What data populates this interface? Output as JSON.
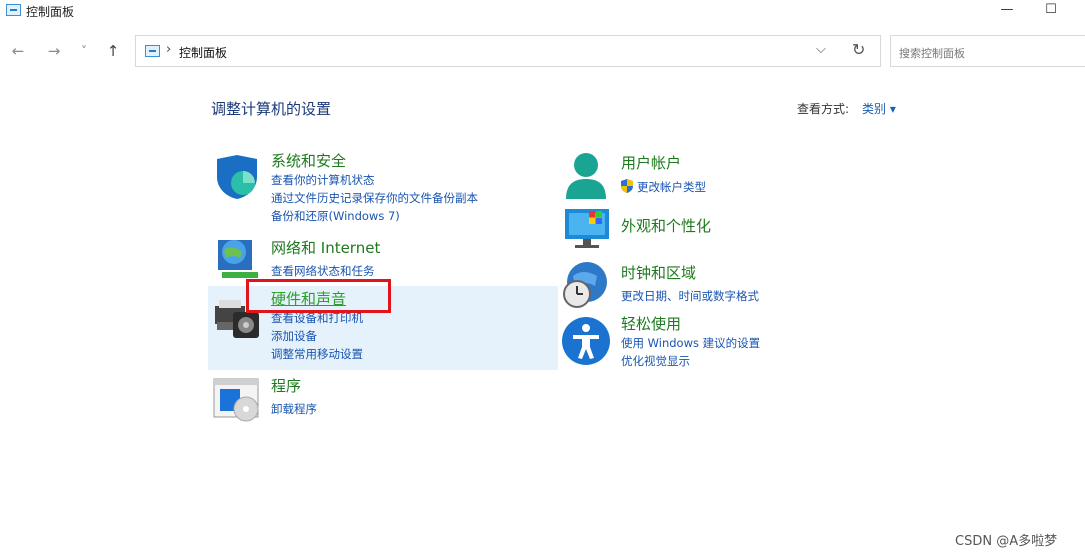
{
  "window": {
    "title": "控制面板",
    "minimize_glyph": "—",
    "maximize_glyph": "☐"
  },
  "nav": {
    "back": "←",
    "forward": "→",
    "recent": "˅",
    "up": "↑"
  },
  "address": {
    "separator": "›",
    "path": "控制面板",
    "dropdown": "⌵",
    "refresh": "↻"
  },
  "search": {
    "placeholder": "搜索控制面板"
  },
  "header": {
    "title": "调整计算机的设置",
    "view_by_label": "查看方式:",
    "view_by_value": "类别 ▾"
  },
  "categories": {
    "security": {
      "title": "系统和安全",
      "links": [
        "查看你的计算机状态",
        "通过文件历史记录保存你的文件备份副本",
        "备份和还原(Windows 7)"
      ]
    },
    "network": {
      "title": "网络和 Internet",
      "links": [
        "查看网络状态和任务"
      ]
    },
    "hardware": {
      "title": "硬件和声音",
      "links": [
        "查看设备和打印机",
        "添加设备",
        "调整常用移动设置"
      ]
    },
    "programs": {
      "title": "程序",
      "links": [
        "卸载程序"
      ]
    },
    "accounts": {
      "title": "用户帐户",
      "links": [
        "更改帐户类型"
      ]
    },
    "appearance": {
      "title": "外观和个性化",
      "links": []
    },
    "clock": {
      "title": "时钟和区域",
      "links": [
        "更改日期、时间或数字格式"
      ]
    },
    "ease": {
      "title": "轻松使用",
      "links": [
        "使用 Windows 建议的设置",
        "优化视觉显示"
      ]
    }
  },
  "watermark": "CSDN @A多啦梦",
  "colors": {
    "category_title": "#1e7a1e",
    "link": "#1a55b0",
    "highlight": "#e5f1fb",
    "annotation_box": "#e0141b"
  }
}
